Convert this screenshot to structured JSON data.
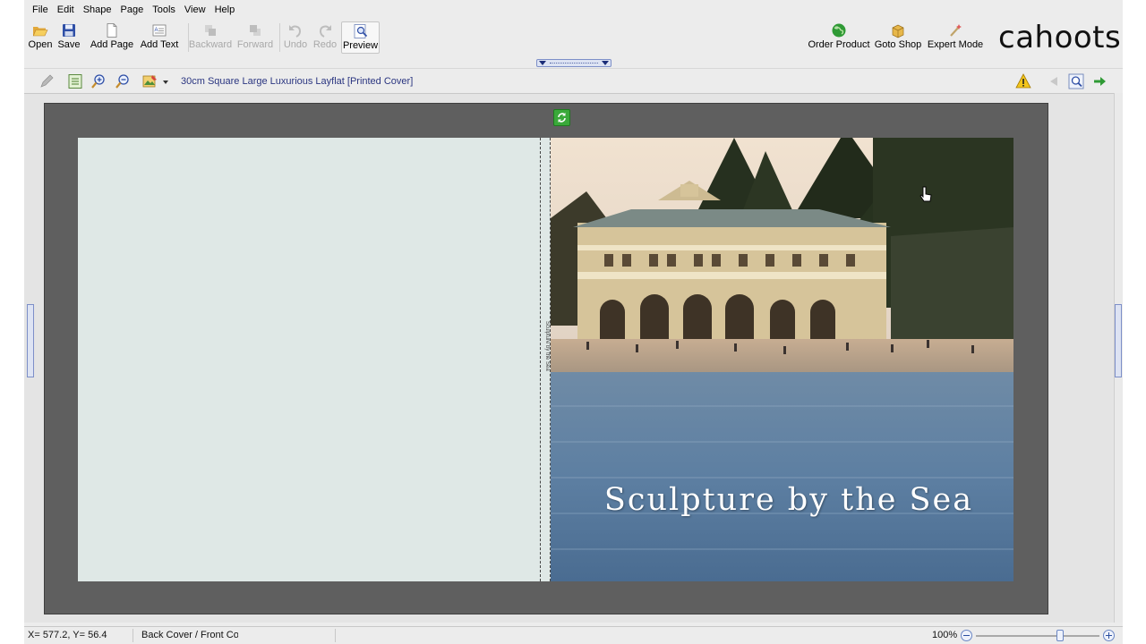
{
  "menu": [
    "File",
    "Edit",
    "Shape",
    "Page",
    "Tools",
    "View",
    "Help"
  ],
  "toolbar": {
    "open": "Open",
    "save": "Save",
    "add_page": "Add Page",
    "add_text": "Add Text",
    "backward": "Backward",
    "forward": "Forward",
    "undo": "Undo",
    "redo": "Redo",
    "preview": "Preview"
  },
  "toolbar_right": {
    "order_product": "Order Product",
    "goto_shop": "Goto Shop",
    "expert_mode": "Expert Mode"
  },
  "brand": "cahoots",
  "product_title": "30cm Square Large Luxurious Layflat [Printed Cover]",
  "spine_text": "Sculpture by the Sea",
  "cover_title": "Sculpture by the Sea",
  "status": {
    "coords": "X= 577.2, Y= 56.4",
    "page_name": "Back Cover / Front Cover",
    "zoom": "100%",
    "zoom_level": 0.68
  },
  "colors": {
    "accent": "#2a3580",
    "back_cover": "#dfe8e6",
    "canvas_frame": "#5f5f5f",
    "refresh": "#3aa93a"
  },
  "icons": [
    "folder-open-icon",
    "floppy-save-icon",
    "page-add-icon",
    "text-add-icon",
    "backward-icon",
    "forward-icon",
    "undo-icon",
    "redo-icon",
    "preview-icon",
    "globe-icon",
    "shop-box-icon",
    "wand-icon",
    "pencil-icon",
    "page-list-icon",
    "zoom-in-icon",
    "zoom-out-icon",
    "image-tool-icon",
    "warning-icon",
    "prev-arrow-icon",
    "view-icon",
    "next-arrow-icon",
    "refresh-icon"
  ]
}
